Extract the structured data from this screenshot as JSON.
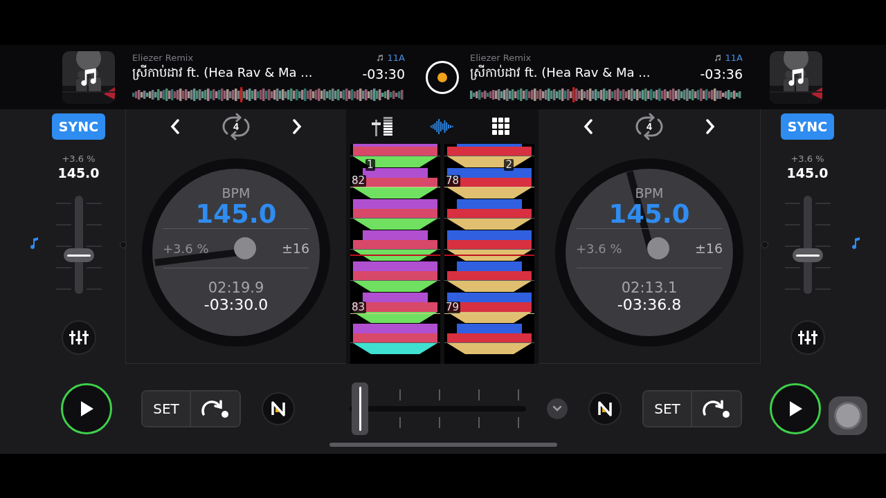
{
  "header": {
    "decks": [
      {
        "artist": "Eliezer Remix",
        "title": "ស្រីកាប់ដាវ ft.  (Hea Rav & Ma ...",
        "key": "11A",
        "remaining": "-03:30",
        "overview": {
          "level": 0.4
        }
      },
      {
        "artist": "Eliezer Remix",
        "title": "ស្រីកាប់ដាវ ft.  (Hea Rav & Ma ...",
        "key": "11A",
        "remaining": "-03:36",
        "overview": {
          "level": 0.38
        }
      }
    ],
    "record": {
      "on": true
    }
  },
  "decks": [
    {
      "sync": {
        "label": "SYNC",
        "on": true
      },
      "pitch": "+3.6 %",
      "bpm": "145.0",
      "loop": "4",
      "platter": {
        "label": "BPM",
        "bpm": "145.0",
        "pitch": "+3.6 %",
        "range": "±16",
        "elapsed": "02:19.9",
        "remaining": "-03:30.0"
      },
      "markers": [
        "1",
        "82",
        "83"
      ],
      "cue": "SET",
      "playing": false
    },
    {
      "sync": {
        "label": "SYNC",
        "on": true
      },
      "pitch": "+3.6 %",
      "bpm": "145.0",
      "loop": "4",
      "platter": {
        "label": "BPM",
        "bpm": "145.0",
        "pitch": "+3.6 %",
        "range": "±16",
        "elapsed": "02:13.1",
        "remaining": "-03:36.8"
      },
      "markers": [
        "2",
        "78",
        "79"
      ],
      "cue": "SET",
      "playing": false
    }
  ],
  "center_tabs": [
    {
      "kind": "mixer",
      "selected": false
    },
    {
      "kind": "waveform",
      "selected": true
    },
    {
      "kind": "pads",
      "selected": false
    }
  ]
}
